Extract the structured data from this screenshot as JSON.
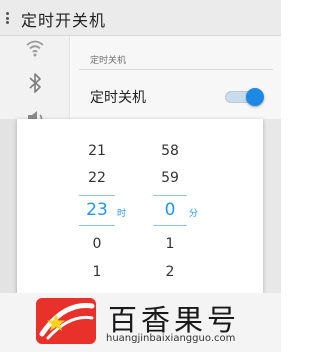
{
  "header": {
    "title": "定时开关机",
    "menu_icon": "menu-dots-icon"
  },
  "sidebar": {
    "icons": [
      "wifi-icon",
      "bluetooth-icon",
      "volume-icon"
    ]
  },
  "content": {
    "section_title": "定时关机",
    "row_label": "定时关机",
    "toggle_on": true
  },
  "picker": {
    "hours": [
      "21",
      "22",
      "23",
      "0",
      "1"
    ],
    "minutes": [
      "58",
      "59",
      "0",
      "1",
      "2"
    ],
    "selected_index": 2,
    "hour_unit": "时",
    "minute_unit": "分",
    "accent_color": "#2196f3"
  },
  "watermark": {
    "name": "百香果号",
    "url": "huangjinbaixiangguo.com",
    "logo_color": "#e8312a"
  }
}
